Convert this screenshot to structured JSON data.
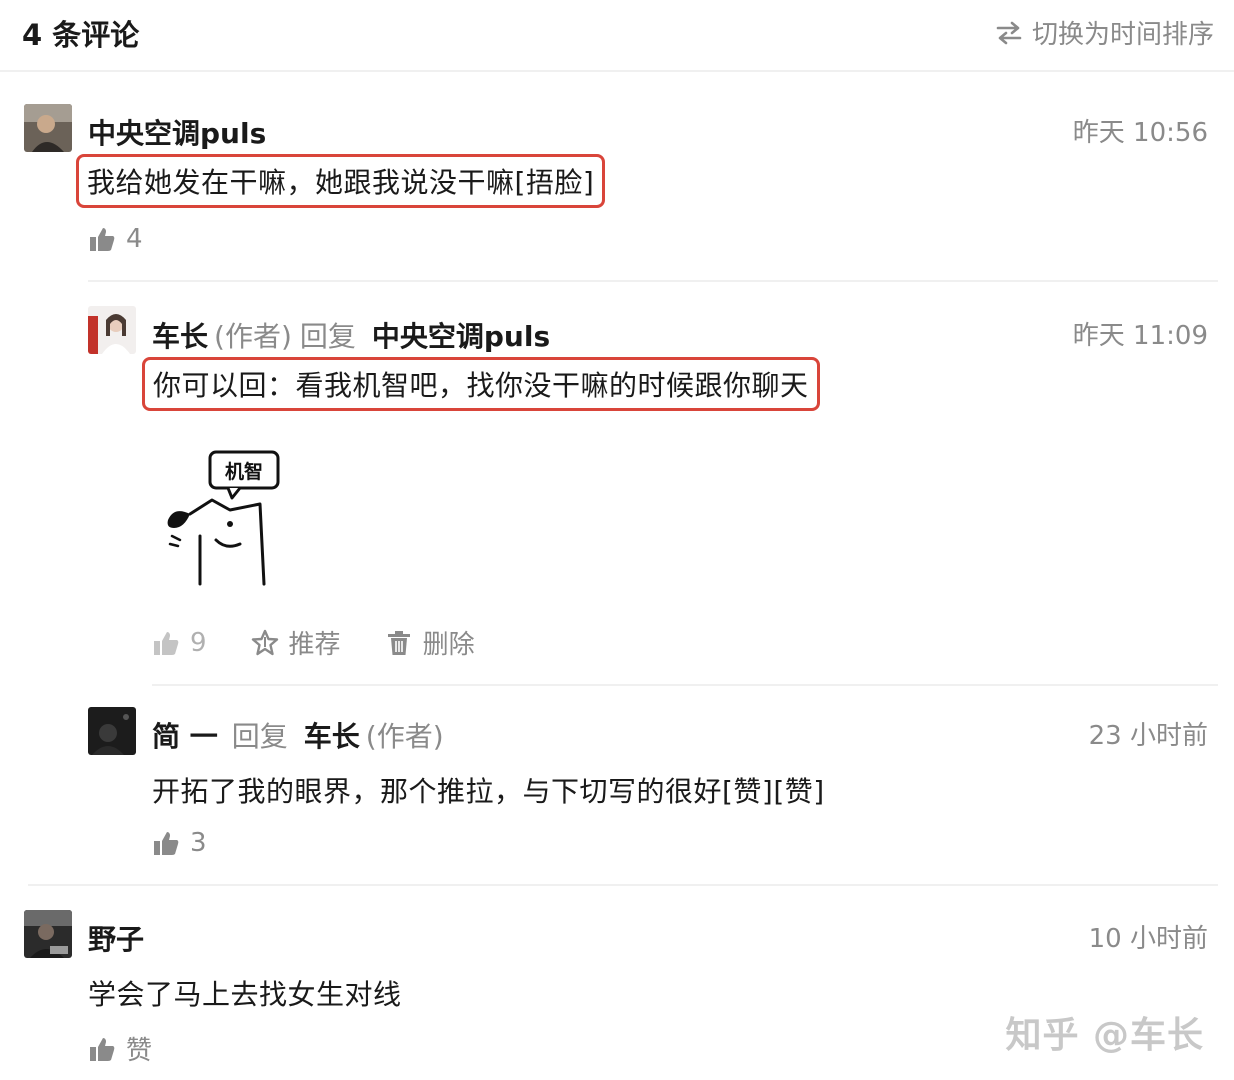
{
  "header": {
    "title": "4 条评论",
    "sort_label": "切换为时间排序"
  },
  "comments": [
    {
      "author": "中央空调puls",
      "time": "昨天 10:56",
      "text": "我给她发在干嘛，她跟我说没干嘛[捂脸]",
      "likes": "4"
    },
    {
      "author": "车长",
      "author_tag": "(作者)",
      "reply_word": "回复",
      "reply_to": "中央空调puls",
      "time": "昨天 11:09",
      "text": "你可以回：看我机智吧，找你没干嘛的时候跟你聊天",
      "sticker_text": "机智",
      "likes": "9",
      "recommend_label": "推荐",
      "delete_label": "删除"
    },
    {
      "author": "简 一",
      "reply_word": "回复",
      "reply_to": "车长",
      "reply_to_tag": "(作者)",
      "time": "23 小时前",
      "text": "开拓了我的眼界，那个推拉，与下切写的很好[赞][赞]",
      "likes": "3"
    },
    {
      "author": "野子",
      "time": "10 小时前",
      "text": "学会了马上去找女生对线",
      "like_label": "赞"
    }
  ],
  "watermark": "知乎 @车长",
  "colors": {
    "highlight_border": "#d9453a",
    "muted_text": "#8a8a8a",
    "divider": "#f0f0f0"
  }
}
